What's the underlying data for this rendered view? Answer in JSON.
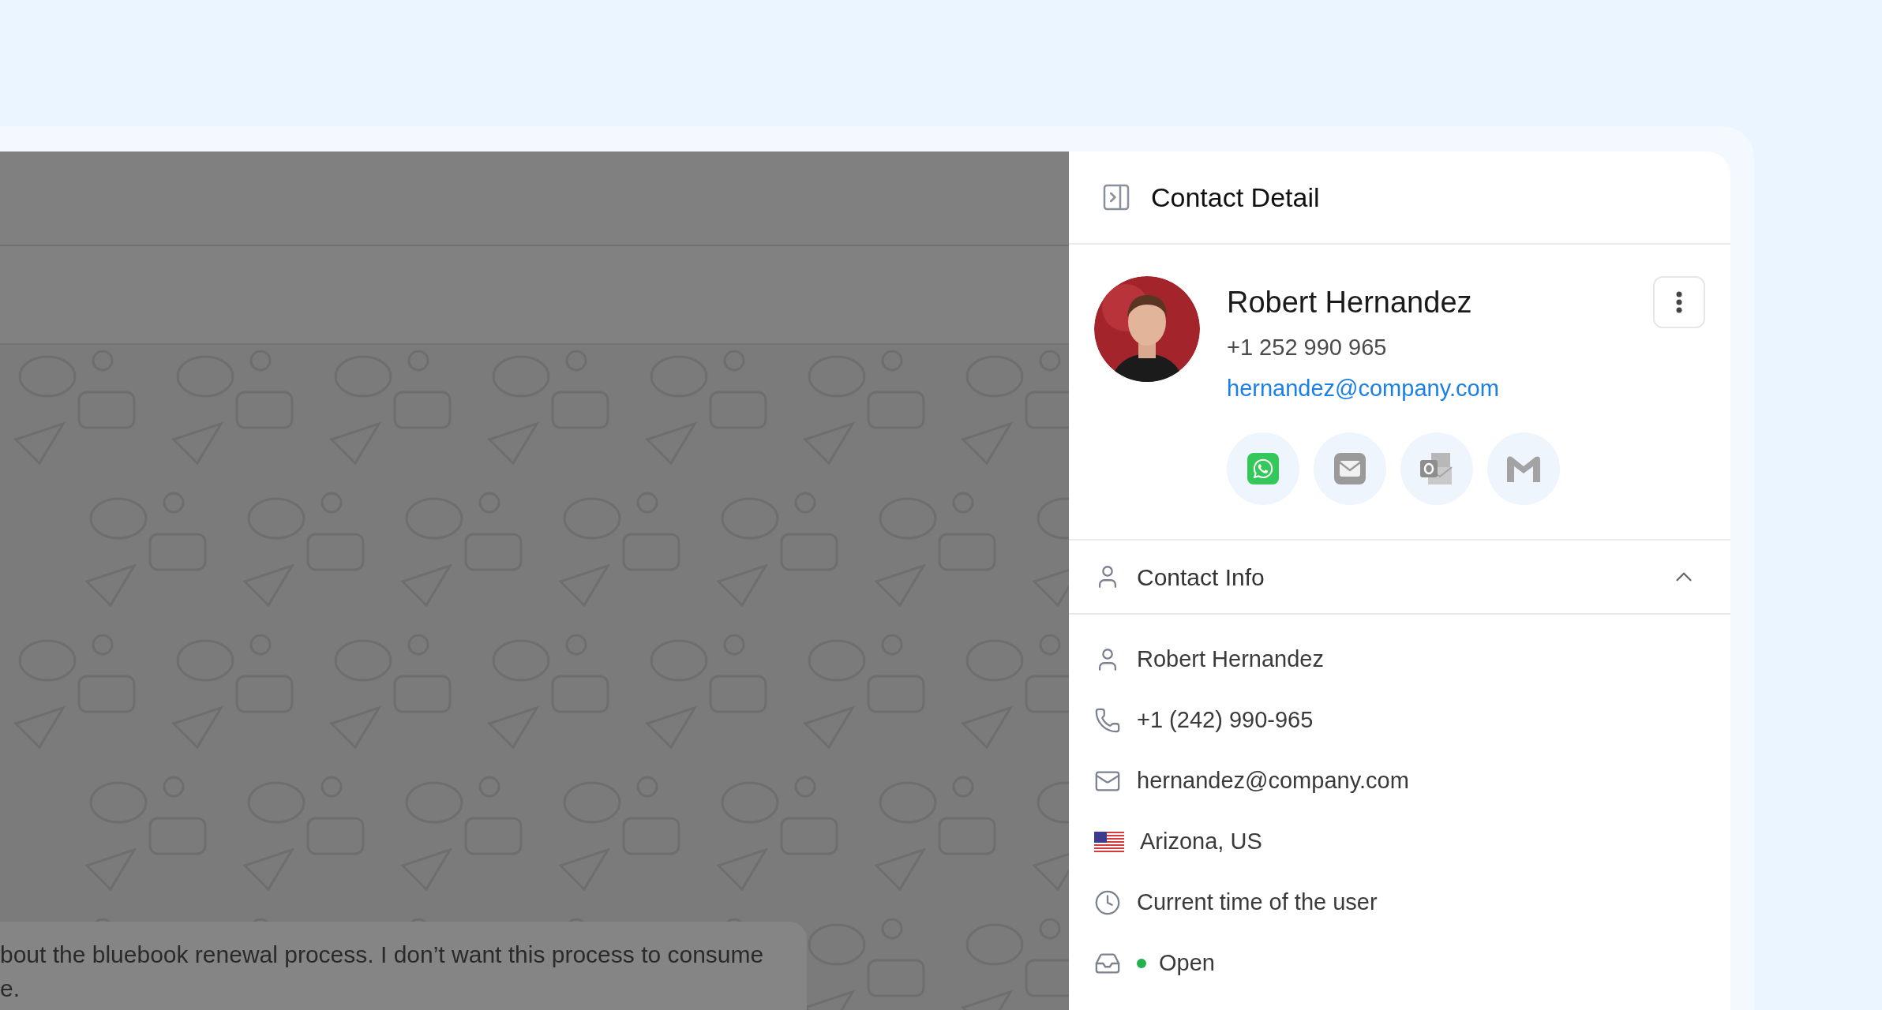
{
  "chat": {
    "message": {
      "lines": [
        "bout the bluebook renewal process. I don’t want this process to consume",
        "e."
      ]
    }
  },
  "panel": {
    "title": "Contact Detail"
  },
  "profile": {
    "name": "Robert Hernandez",
    "phone": "+1 252 990 965",
    "email": "hernandez@company.com",
    "channels": [
      {
        "kind": "whatsapp"
      },
      {
        "kind": "mail"
      },
      {
        "kind": "outlook"
      },
      {
        "kind": "gmail"
      }
    ]
  },
  "contact_info": {
    "title": "Contact Info",
    "expanded": true,
    "rows": [
      {
        "kind": "person",
        "text": "Robert Hernandez"
      },
      {
        "kind": "phone",
        "text": "+1 (242) 990-965"
      },
      {
        "kind": "email",
        "text": "hernandez@company.com"
      },
      {
        "kind": "flag",
        "text": "Arizona, US"
      },
      {
        "kind": "time",
        "text": "Current time of the user"
      },
      {
        "kind": "status",
        "text": "Open",
        "color": "#22b14c"
      }
    ]
  }
}
